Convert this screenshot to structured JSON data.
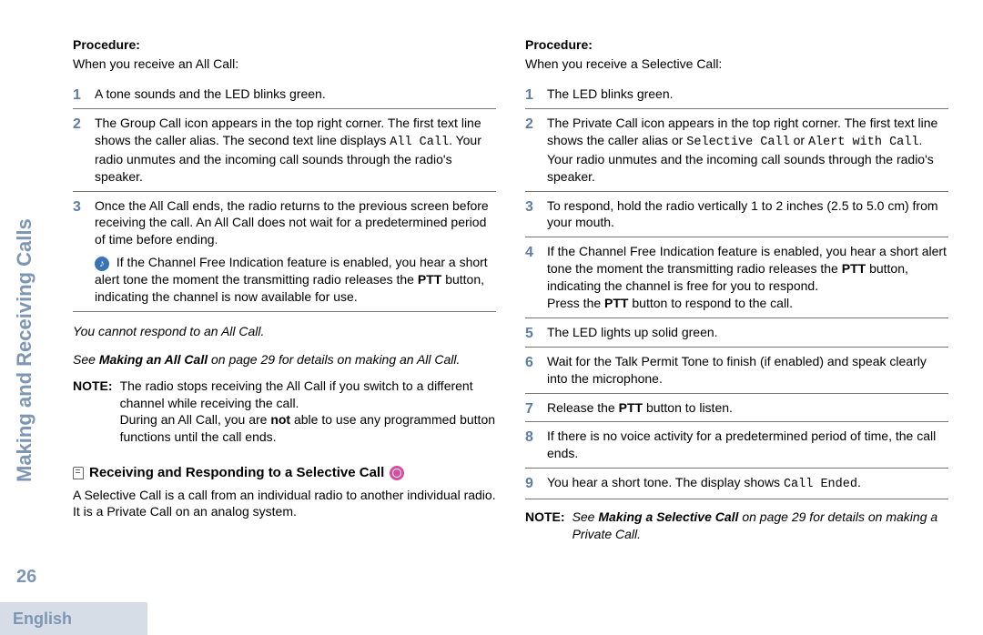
{
  "sidebar": {
    "title": "Making and Receiving Calls",
    "page_number": "26",
    "language": "English"
  },
  "left": {
    "procedure_label": "Procedure:",
    "intro": "When you receive an All Call:",
    "steps": {
      "s1": "A tone sounds and the LED blinks green.",
      "s2a": "The Group Call icon appears in the top right corner. The first text line shows the caller alias. The second text line displays ",
      "s2_code": "All Call",
      "s2b": ". Your radio unmutes and the incoming call sounds through the radio's speaker.",
      "s3": "Once the All Call ends, the radio returns to the previous screen before receiving the call. An All Call does not wait for a predetermined period of time before ending.",
      "s3_note_a": " If the Channel Free Indication feature is enabled, you hear a short alert tone the moment the transmitting radio releases the ",
      "s3_note_ptt": "PTT",
      "s3_note_b": " button, indicating the channel is now available for use."
    },
    "no_respond": "You cannot respond to an All Call.",
    "see_a": "See ",
    "see_bold": "Making an All Call",
    "see_b": " on page 29 for details on making an All Call.",
    "note_label": "NOTE:",
    "note_body_a": "The radio stops receiving the All Call if you switch to a different channel while receiving the call.",
    "note_body_b1": "During an All Call, you are ",
    "note_body_not": "not",
    "note_body_b2": " able to use any programmed button functions until the call ends.",
    "heading": "Receiving and Responding to a Selective Call",
    "heading_body": "A Selective Call is a call from an individual radio to another individual radio. It is a Private Call on an analog system."
  },
  "right": {
    "procedure_label": "Procedure:",
    "intro": "When you receive a Selective Call:",
    "steps": {
      "s1": "The LED blinks green.",
      "s2a": "The Private Call icon appears in the top right corner. The first text line shows the caller alias or ",
      "s2_code1": "Selective Call",
      "s2_mid": " or ",
      "s2_code2": "Alert with Call",
      "s2b": ". Your radio unmutes and the incoming call sounds through the radio's speaker.",
      "s3": "To respond, hold the radio vertically 1 to 2 inches (2.5 to 5.0 cm) from your mouth.",
      "s4a": "If the Channel Free Indication feature is enabled, you hear a short alert tone the moment the transmitting radio releases the ",
      "s4_ptt1": "PTT",
      "s4b": " button, indicating the channel is free for you to respond.",
      "s4c": "Press the ",
      "s4_ptt2": "PTT",
      "s4d": " button to respond to the call.",
      "s5": "The LED lights up solid green.",
      "s6": "Wait for the Talk Permit Tone to finish (if enabled) and speak clearly into the microphone.",
      "s7a": "Release the ",
      "s7_ptt": "PTT",
      "s7b": " button to listen.",
      "s8": "If there is no voice activity for a predetermined period of time, the call ends.",
      "s9a": "You hear a short tone. The display shows ",
      "s9_code": "Call Ended",
      "s9b": "."
    },
    "note_label": "NOTE:",
    "note_see_a": "See ",
    "note_see_bold": "Making a Selective Call",
    "note_see_b": " on page 29 for details on making a Private Call."
  }
}
